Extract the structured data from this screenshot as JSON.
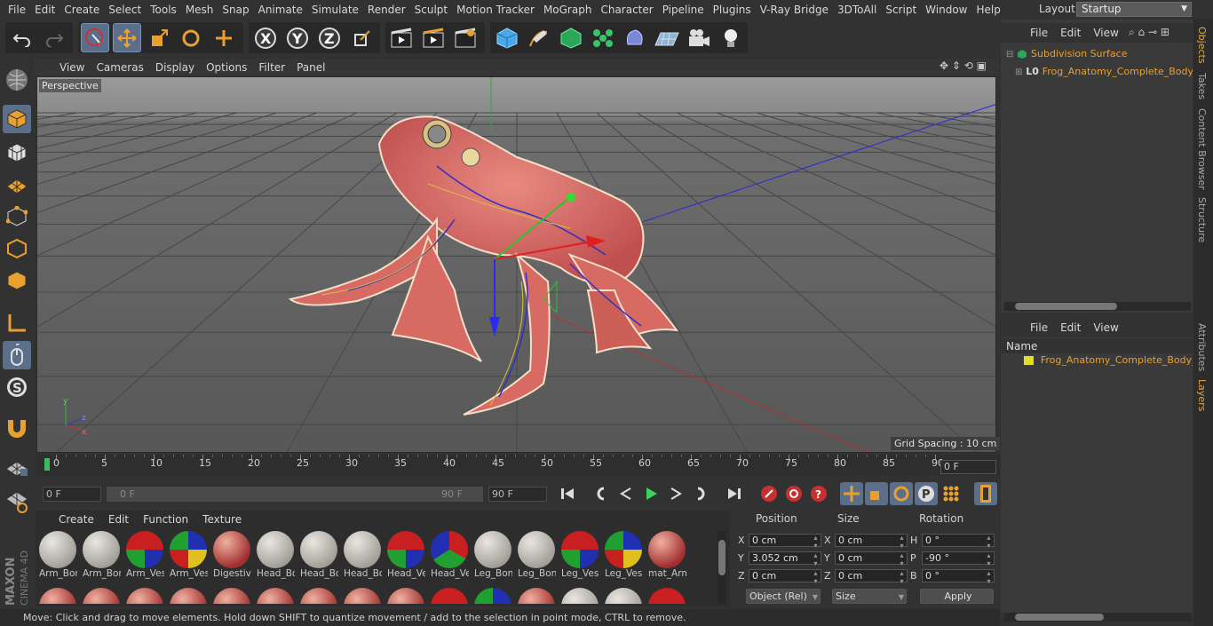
{
  "menubar": {
    "items": [
      "File",
      "Edit",
      "Create",
      "Select",
      "Tools",
      "Mesh",
      "Snap",
      "Animate",
      "Simulate",
      "Render",
      "Sculpt",
      "Motion Tracker",
      "MoGraph",
      "Character",
      "Pipeline",
      "Plugins",
      "V-Ray Bridge",
      "3DToAll",
      "Script",
      "Window",
      "Help"
    ],
    "layout_label": "Layout:",
    "layout_value": "Startup"
  },
  "viewport": {
    "menu": [
      "View",
      "Cameras",
      "Display",
      "Options",
      "Filter",
      "Panel"
    ],
    "label": "Perspective",
    "grid_spacing": "Grid Spacing : 10 cm"
  },
  "timeline": {
    "ticks": [
      "0",
      "5",
      "10",
      "15",
      "20",
      "25",
      "30",
      "35",
      "40",
      "45",
      "50",
      "55",
      "60",
      "65",
      "70",
      "75",
      "80",
      "85",
      "90"
    ],
    "current_frame": "0 F"
  },
  "controls": {
    "start": "0 F",
    "range_start": "0 F",
    "range_end": "90 F",
    "end": "90 F"
  },
  "materials": {
    "menu": [
      "Create",
      "Edit",
      "Function",
      "Texture"
    ],
    "row1": [
      "Arm_Bor",
      "Arm_Bor",
      "Arm_Ves",
      "Arm_Ves",
      "Digestiv",
      "Head_Bo",
      "Head_Bo",
      "Head_Bo",
      "Head_Ve",
      "Head_Ve",
      "Leg_Bon",
      "Leg_Bon",
      "Leg_Ves",
      "Leg_Ves",
      "mat_Arm"
    ]
  },
  "coords": {
    "headers": [
      "Position",
      "Size",
      "Rotation"
    ],
    "rows": [
      {
        "axis": "X",
        "pos": "0 cm",
        "saxis": "X",
        "size": "0 cm",
        "raxis": "H",
        "rot": "0 °"
      },
      {
        "axis": "Y",
        "pos": "3.052 cm",
        "saxis": "Y",
        "size": "0 cm",
        "raxis": "P",
        "rot": "-90 °"
      },
      {
        "axis": "Z",
        "pos": "0 cm",
        "saxis": "Z",
        "size": "0 cm",
        "raxis": "B",
        "rot": "0 °"
      }
    ],
    "mode": "Object (Rel)",
    "size_mode": "Size",
    "apply": "Apply"
  },
  "objects": {
    "menu": [
      "File",
      "Edit",
      "View"
    ],
    "items": [
      "Subdivision Surface",
      "Frog_Anatomy_Complete_Body_T"
    ]
  },
  "layers": {
    "menu": [
      "File",
      "Edit",
      "View"
    ],
    "header": "Name",
    "items": [
      "Frog_Anatomy_Complete_Body_Tr"
    ]
  },
  "sidetabs": [
    "Objects",
    "Takes",
    "Content Browser",
    "Structure",
    "Attributes",
    "Layers"
  ],
  "status": "Move: Click and drag to move elements. Hold down SHIFT to quantize movement / add to the selection in point mode, CTRL to remove.",
  "brand": "MAXON CINEMA 4D"
}
